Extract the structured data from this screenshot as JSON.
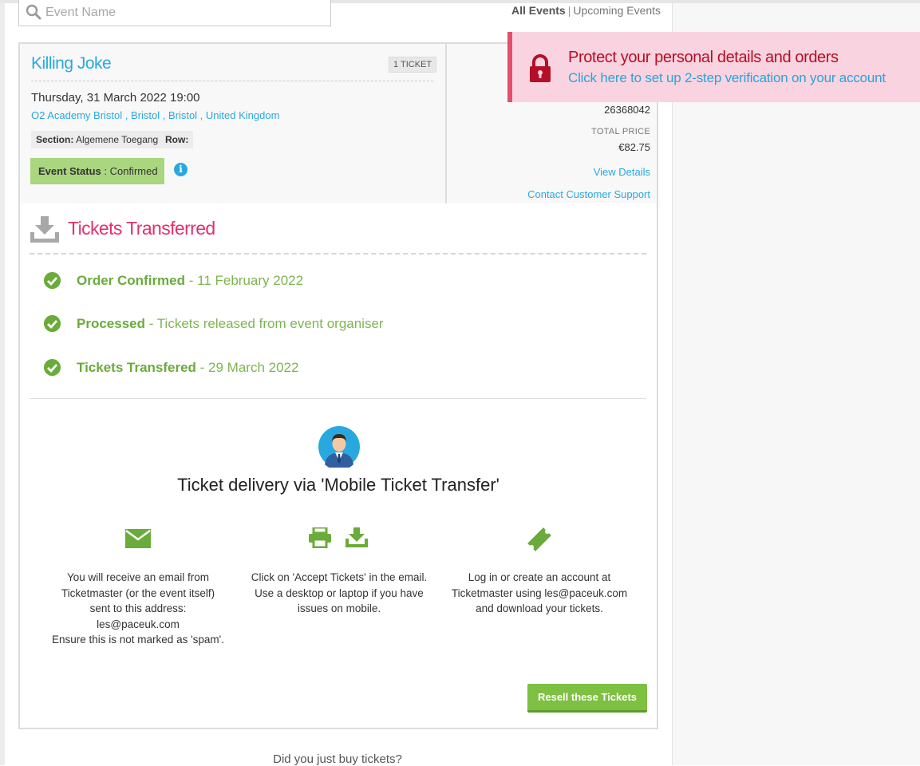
{
  "search": {
    "placeholder": "Event Name"
  },
  "filter": {
    "active": "All Events",
    "separator": "|",
    "other": "Upcoming Events"
  },
  "event": {
    "title": "Killing Joke",
    "ticket_badge": "1 TICKET",
    "date": "Thursday, 31 March 2022 19:00",
    "venue": "O2 Academy Bristol , Bristol , Bristol , United Kingdom",
    "section_label": "Section:",
    "section_value": "Algemene Toegang",
    "row_label": "Row:",
    "status_label": "Event Status",
    "status_value": ": Confirmed",
    "order_number": "26368042",
    "total_label": "TOTAL PRICE",
    "total_value": "€82.75",
    "view_details": "View Details",
    "contact_support": "Contact Customer Support"
  },
  "alert": {
    "title": "Protect your personal details and orders",
    "link": "Click here to set up 2-step verification on your account"
  },
  "transfer": {
    "title": "Tickets Transferred",
    "steps": [
      {
        "name": "Order Confirmed",
        "detail": " - 11 February 2022"
      },
      {
        "name": "Processed",
        "detail": " - Tickets released from event organiser"
      },
      {
        "name": "Tickets Transfered",
        "detail": " - 29 March 2022"
      }
    ],
    "delivery_title": "Ticket delivery via 'Mobile Ticket Transfer'",
    "columns": [
      {
        "icon": "email-icon",
        "lines": [
          "You will receive an email from",
          "Ticketmaster (or the event itself)",
          "sent to this address:",
          "les@paceuk.com",
          "Ensure this is not marked as 'spam'."
        ]
      },
      {
        "icon": "print-download-icon",
        "lines": [
          "Click on 'Accept Tickets' in the email.",
          "Use a desktop or laptop if you have",
          "issues on mobile."
        ]
      },
      {
        "icon": "ticket-icon",
        "lines": [
          "Log in or create an account at",
          "Ticketmaster using les@paceuk.com",
          "and download your tickets."
        ]
      }
    ],
    "resell_button": "Resell these Tickets"
  },
  "footer": {
    "question": "Did you just buy tickets?"
  },
  "colors": {
    "accent_blue": "#29a8e0",
    "pink": "#e2306f",
    "green": "#6aab3a",
    "alert_bg": "#f9d3df",
    "alert_red": "#b40f27"
  }
}
